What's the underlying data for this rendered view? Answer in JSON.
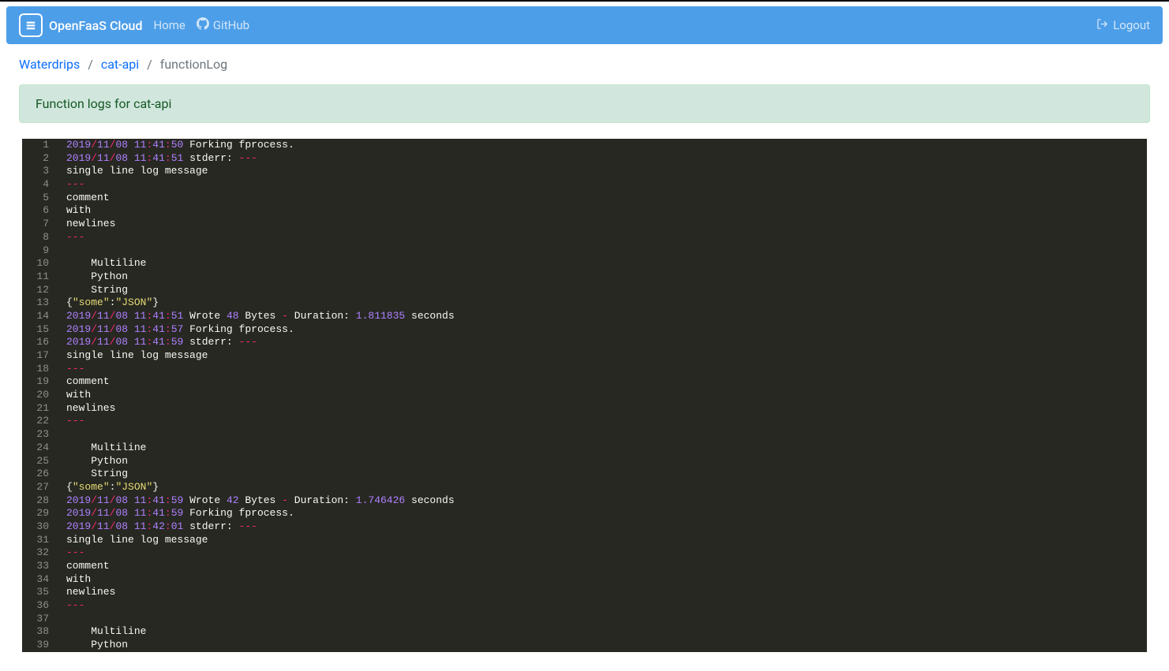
{
  "navbar": {
    "brand": "OpenFaaS Cloud",
    "home": "Home",
    "github": "GitHub",
    "logout": "Logout"
  },
  "breadcrumb": {
    "items": [
      {
        "label": "Waterdrips",
        "link": true
      },
      {
        "label": "cat-api",
        "link": true
      },
      {
        "label": "functionLog",
        "link": false
      }
    ]
  },
  "banner": {
    "text": "Function logs for cat-api"
  },
  "log": {
    "lines": [
      [
        {
          "t": "num",
          "v": "2019"
        },
        {
          "t": "op",
          "v": "/"
        },
        {
          "t": "num",
          "v": "11"
        },
        {
          "t": "op",
          "v": "/"
        },
        {
          "t": "num",
          "v": "08"
        },
        {
          "t": "white",
          "v": " "
        },
        {
          "t": "num",
          "v": "11"
        },
        {
          "t": "red",
          "v": ":"
        },
        {
          "t": "num",
          "v": "41"
        },
        {
          "t": "red",
          "v": ":"
        },
        {
          "t": "num",
          "v": "50"
        },
        {
          "t": "white",
          "v": " Forking fprocess."
        }
      ],
      [
        {
          "t": "num",
          "v": "2019"
        },
        {
          "t": "op",
          "v": "/"
        },
        {
          "t": "num",
          "v": "11"
        },
        {
          "t": "op",
          "v": "/"
        },
        {
          "t": "num",
          "v": "08"
        },
        {
          "t": "white",
          "v": " "
        },
        {
          "t": "num",
          "v": "11"
        },
        {
          "t": "red",
          "v": ":"
        },
        {
          "t": "num",
          "v": "41"
        },
        {
          "t": "red",
          "v": ":"
        },
        {
          "t": "num",
          "v": "51"
        },
        {
          "t": "white",
          "v": " stderr: "
        },
        {
          "t": "red",
          "v": "---"
        }
      ],
      [
        {
          "t": "white",
          "v": "single line log message"
        }
      ],
      [
        {
          "t": "red",
          "v": "---"
        }
      ],
      [
        {
          "t": "white",
          "v": "comment"
        }
      ],
      [
        {
          "t": "white",
          "v": "with"
        }
      ],
      [
        {
          "t": "white",
          "v": "newlines"
        }
      ],
      [
        {
          "t": "red",
          "v": "---"
        }
      ],
      [
        {
          "t": "white",
          "v": ""
        }
      ],
      [
        {
          "t": "white",
          "v": "    Multiline"
        }
      ],
      [
        {
          "t": "white",
          "v": "    Python"
        }
      ],
      [
        {
          "t": "white",
          "v": "    String"
        }
      ],
      [
        {
          "t": "white",
          "v": "{"
        },
        {
          "t": "str",
          "v": "\"some\""
        },
        {
          "t": "white",
          "v": ":"
        },
        {
          "t": "str",
          "v": "\"JSON\""
        },
        {
          "t": "white",
          "v": "}"
        }
      ],
      [
        {
          "t": "num",
          "v": "2019"
        },
        {
          "t": "op",
          "v": "/"
        },
        {
          "t": "num",
          "v": "11"
        },
        {
          "t": "op",
          "v": "/"
        },
        {
          "t": "num",
          "v": "08"
        },
        {
          "t": "white",
          "v": " "
        },
        {
          "t": "num",
          "v": "11"
        },
        {
          "t": "red",
          "v": ":"
        },
        {
          "t": "num",
          "v": "41"
        },
        {
          "t": "red",
          "v": ":"
        },
        {
          "t": "num",
          "v": "51"
        },
        {
          "t": "white",
          "v": " Wrote "
        },
        {
          "t": "num",
          "v": "48"
        },
        {
          "t": "white",
          "v": " Bytes "
        },
        {
          "t": "op",
          "v": "-"
        },
        {
          "t": "white",
          "v": " Duration: "
        },
        {
          "t": "num",
          "v": "1.811835"
        },
        {
          "t": "white",
          "v": " seconds"
        }
      ],
      [
        {
          "t": "num",
          "v": "2019"
        },
        {
          "t": "op",
          "v": "/"
        },
        {
          "t": "num",
          "v": "11"
        },
        {
          "t": "op",
          "v": "/"
        },
        {
          "t": "num",
          "v": "08"
        },
        {
          "t": "white",
          "v": " "
        },
        {
          "t": "num",
          "v": "11"
        },
        {
          "t": "red",
          "v": ":"
        },
        {
          "t": "num",
          "v": "41"
        },
        {
          "t": "red",
          "v": ":"
        },
        {
          "t": "num",
          "v": "57"
        },
        {
          "t": "white",
          "v": " Forking fprocess."
        }
      ],
      [
        {
          "t": "num",
          "v": "2019"
        },
        {
          "t": "op",
          "v": "/"
        },
        {
          "t": "num",
          "v": "11"
        },
        {
          "t": "op",
          "v": "/"
        },
        {
          "t": "num",
          "v": "08"
        },
        {
          "t": "white",
          "v": " "
        },
        {
          "t": "num",
          "v": "11"
        },
        {
          "t": "red",
          "v": ":"
        },
        {
          "t": "num",
          "v": "41"
        },
        {
          "t": "red",
          "v": ":"
        },
        {
          "t": "num",
          "v": "59"
        },
        {
          "t": "white",
          "v": " stderr: "
        },
        {
          "t": "red",
          "v": "---"
        }
      ],
      [
        {
          "t": "white",
          "v": "single line log message"
        }
      ],
      [
        {
          "t": "red",
          "v": "---"
        }
      ],
      [
        {
          "t": "white",
          "v": "comment"
        }
      ],
      [
        {
          "t": "white",
          "v": "with"
        }
      ],
      [
        {
          "t": "white",
          "v": "newlines"
        }
      ],
      [
        {
          "t": "red",
          "v": "---"
        }
      ],
      [
        {
          "t": "white",
          "v": ""
        }
      ],
      [
        {
          "t": "white",
          "v": "    Multiline"
        }
      ],
      [
        {
          "t": "white",
          "v": "    Python"
        }
      ],
      [
        {
          "t": "white",
          "v": "    String"
        }
      ],
      [
        {
          "t": "white",
          "v": "{"
        },
        {
          "t": "str",
          "v": "\"some\""
        },
        {
          "t": "white",
          "v": ":"
        },
        {
          "t": "str",
          "v": "\"JSON\""
        },
        {
          "t": "white",
          "v": "}"
        }
      ],
      [
        {
          "t": "num",
          "v": "2019"
        },
        {
          "t": "op",
          "v": "/"
        },
        {
          "t": "num",
          "v": "11"
        },
        {
          "t": "op",
          "v": "/"
        },
        {
          "t": "num",
          "v": "08"
        },
        {
          "t": "white",
          "v": " "
        },
        {
          "t": "num",
          "v": "11"
        },
        {
          "t": "red",
          "v": ":"
        },
        {
          "t": "num",
          "v": "41"
        },
        {
          "t": "red",
          "v": ":"
        },
        {
          "t": "num",
          "v": "59"
        },
        {
          "t": "white",
          "v": " Wrote "
        },
        {
          "t": "num",
          "v": "42"
        },
        {
          "t": "white",
          "v": " Bytes "
        },
        {
          "t": "op",
          "v": "-"
        },
        {
          "t": "white",
          "v": " Duration: "
        },
        {
          "t": "num",
          "v": "1.746426"
        },
        {
          "t": "white",
          "v": " seconds"
        }
      ],
      [
        {
          "t": "num",
          "v": "2019"
        },
        {
          "t": "op",
          "v": "/"
        },
        {
          "t": "num",
          "v": "11"
        },
        {
          "t": "op",
          "v": "/"
        },
        {
          "t": "num",
          "v": "08"
        },
        {
          "t": "white",
          "v": " "
        },
        {
          "t": "num",
          "v": "11"
        },
        {
          "t": "red",
          "v": ":"
        },
        {
          "t": "num",
          "v": "41"
        },
        {
          "t": "red",
          "v": ":"
        },
        {
          "t": "num",
          "v": "59"
        },
        {
          "t": "white",
          "v": " Forking fprocess."
        }
      ],
      [
        {
          "t": "num",
          "v": "2019"
        },
        {
          "t": "op",
          "v": "/"
        },
        {
          "t": "num",
          "v": "11"
        },
        {
          "t": "op",
          "v": "/"
        },
        {
          "t": "num",
          "v": "08"
        },
        {
          "t": "white",
          "v": " "
        },
        {
          "t": "num",
          "v": "11"
        },
        {
          "t": "red",
          "v": ":"
        },
        {
          "t": "num",
          "v": "42"
        },
        {
          "t": "red",
          "v": ":"
        },
        {
          "t": "num",
          "v": "01"
        },
        {
          "t": "white",
          "v": " stderr: "
        },
        {
          "t": "red",
          "v": "---"
        }
      ],
      [
        {
          "t": "white",
          "v": "single line log message"
        }
      ],
      [
        {
          "t": "red",
          "v": "---"
        }
      ],
      [
        {
          "t": "white",
          "v": "comment"
        }
      ],
      [
        {
          "t": "white",
          "v": "with"
        }
      ],
      [
        {
          "t": "white",
          "v": "newlines"
        }
      ],
      [
        {
          "t": "red",
          "v": "---"
        }
      ],
      [
        {
          "t": "white",
          "v": ""
        }
      ],
      [
        {
          "t": "white",
          "v": "    Multiline"
        }
      ],
      [
        {
          "t": "white",
          "v": "    Python"
        }
      ]
    ]
  }
}
